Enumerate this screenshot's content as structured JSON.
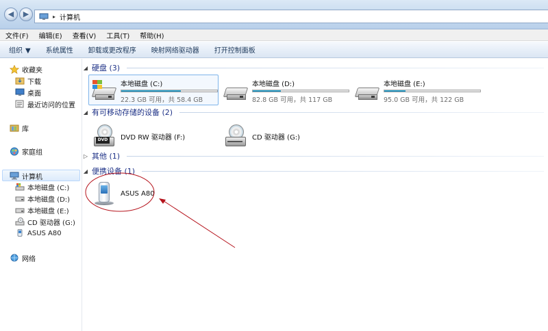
{
  "window": {
    "breadcrumb_separator": "▸",
    "address_crumb": "计算机"
  },
  "menu": [
    "文件(F)",
    "编辑(E)",
    "查看(V)",
    "工具(T)",
    "帮助(H)"
  ],
  "commands": {
    "organize": "组织",
    "system_properties": "系统属性",
    "uninstall": "卸载或更改程序",
    "map_drive": "映射网络驱动器",
    "control_panel": "打开控制面板"
  },
  "sidebar": {
    "favorites": "收藏夹",
    "downloads": "下载",
    "desktop": "桌面",
    "recent": "最近访问的位置",
    "libraries": "库",
    "homegroup": "家庭组",
    "computer": "计算机",
    "drive_c": "本地磁盘 (C:)",
    "drive_d": "本地磁盘 (D:)",
    "drive_e": "本地磁盘 (E:)",
    "drive_g": "CD 驱动器 (G:)",
    "device": "ASUS A80",
    "network": "网络"
  },
  "groups": {
    "hard_disks": "硬盘 (3)",
    "removable": "有可移动存储的设备 (2)",
    "other": "其他 (1)",
    "portable": "便携设备 (1)"
  },
  "drives": [
    {
      "name": "本地磁盘 (C:)",
      "space": "22.3 GB 可用，共 58.4 GB",
      "used_fraction": 0.62
    },
    {
      "name": "本地磁盘 (D:)",
      "space": "82.8 GB 可用，共 117 GB",
      "used_fraction": 0.29
    },
    {
      "name": "本地磁盘 (E:)",
      "space": "95.0 GB 可用，共 122 GB",
      "used_fraction": 0.22
    }
  ],
  "removable_devices": {
    "dvd_name": "DVD RW 驱动器 (F:)",
    "dvd_badge": "DVD",
    "cd_name": "CD 驱动器 (G:)"
  },
  "portable_device": {
    "name": "ASUS A80"
  },
  "colors": {
    "group_header": "#1e3287",
    "annotation": "#b5121b",
    "bar_fill": "#1e95c3"
  }
}
